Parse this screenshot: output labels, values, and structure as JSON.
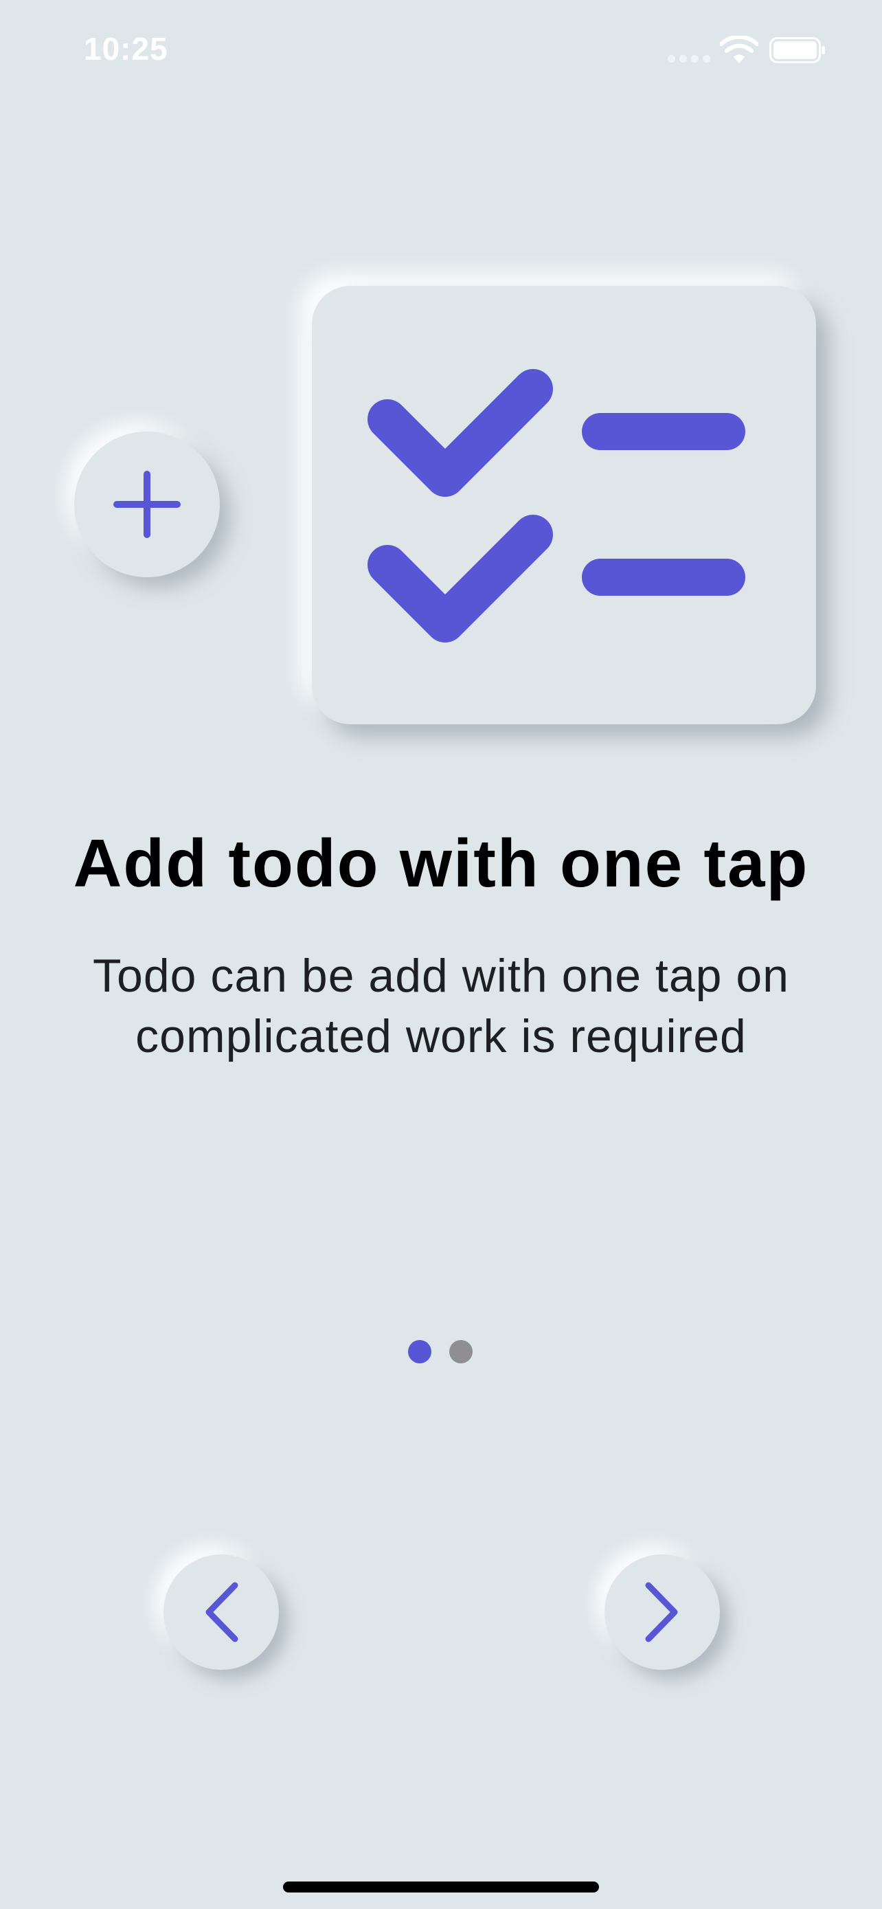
{
  "status_bar": {
    "time": "10:25"
  },
  "illustration": {
    "plus_icon": "plus-icon",
    "checklist_icon": "checklist-icon"
  },
  "onboarding": {
    "title": "Add todo with one tap",
    "description": "Todo can be add with one tap on complicated work is required"
  },
  "pagination": {
    "current_page": 1,
    "total_pages": 2
  },
  "navigation": {
    "prev_icon": "chevron-left-icon",
    "next_icon": "chevron-right-icon"
  },
  "colors": {
    "background": "#dfe6ea",
    "accent": "#5956d6",
    "inactive_dot": "#8e8e93",
    "title": "#000000",
    "body": "#1e1f22"
  }
}
